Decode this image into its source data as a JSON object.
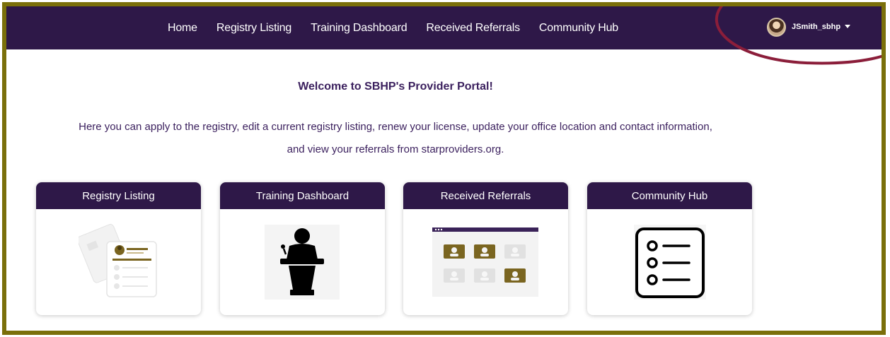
{
  "nav": {
    "links": [
      "Home",
      "Registry Listing",
      "Training Dashboard",
      "Received Referrals",
      "Community Hub"
    ],
    "user_name": "JSmith_sbhp"
  },
  "main": {
    "welcome": "Welcome to SBHP's Provider Portal!",
    "intro_line1": "Here you can apply to the registry, edit a current registry listing, renew your license, update your office location and contact information,",
    "intro_line2": "and view your referrals from starproviders.org."
  },
  "cards": [
    {
      "title": "Registry Listing",
      "icon": "registry-profile-icon"
    },
    {
      "title": "Training Dashboard",
      "icon": "speaker-podium-icon"
    },
    {
      "title": "Received Referrals",
      "icon": "referrals-grid-icon"
    },
    {
      "title": "Community Hub",
      "icon": "checklist-icon"
    }
  ],
  "colors": {
    "nav_bg": "#2e1848",
    "frame_border": "#7a6f0a",
    "heading_text": "#3a1f5d",
    "accent_gold": "#7a6520",
    "annotation_oval": "#8b1e3a"
  }
}
